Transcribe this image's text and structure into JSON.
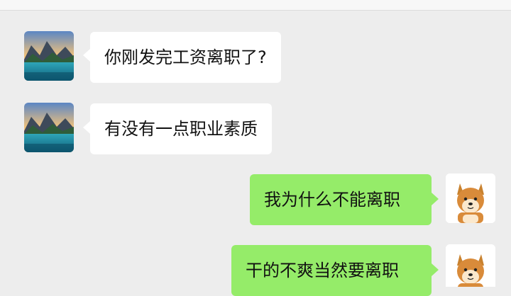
{
  "messages": [
    {
      "sender": "other",
      "avatar_icon": "mountain-lake-avatar-icon",
      "text": "你刚发完工资离职了?"
    },
    {
      "sender": "other",
      "avatar_icon": "mountain-lake-avatar-icon",
      "text": "有没有一点职业素质"
    },
    {
      "sender": "self",
      "avatar_icon": "shiba-dog-avatar-icon",
      "text": "我为什么不能离职"
    },
    {
      "sender": "self",
      "avatar_icon": "shiba-dog-avatar-icon",
      "text": "干的不爽当然要离职"
    }
  ],
  "colors": {
    "background": "#ededed",
    "incoming_bubble": "#ffffff",
    "outgoing_bubble": "#95ec69"
  }
}
